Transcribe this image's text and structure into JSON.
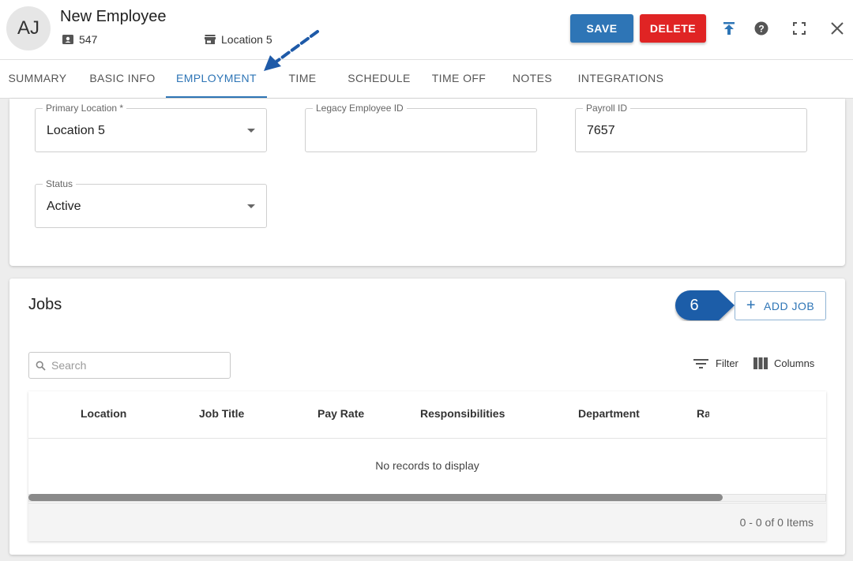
{
  "header": {
    "avatar_initials": "AJ",
    "employee_name": "New Employee",
    "employee_id": "547",
    "location": "Location 5",
    "save_label": "SAVE",
    "delete_label": "DELETE",
    "colors": {
      "save": "#2e75b6",
      "delete": "#e02424",
      "accent": "#2e75b6"
    }
  },
  "tabs": [
    {
      "label": "SUMMARY"
    },
    {
      "label": "BASIC INFO"
    },
    {
      "label": "EMPLOYMENT",
      "active": true
    },
    {
      "label": "TIME"
    },
    {
      "label": "SCHEDULE"
    },
    {
      "label": "TIME OFF"
    },
    {
      "label": "NOTES"
    },
    {
      "label": "INTEGRATIONS"
    }
  ],
  "employment": {
    "primary_location": {
      "label": "Primary Location *",
      "value": "Location 5"
    },
    "legacy_employee_id": {
      "label": "Legacy Employee ID",
      "value": ""
    },
    "payroll_id": {
      "label": "Payroll ID",
      "value": "7657"
    },
    "status": {
      "label": "Status",
      "value": "Active"
    }
  },
  "jobs": {
    "title": "Jobs",
    "add_job_label": "ADD JOB",
    "callout_number": "6",
    "search_placeholder": "Search",
    "filter_label": "Filter",
    "columns_label": "Columns",
    "columns": [
      "Location",
      "Job Title",
      "Pay Rate",
      "Responsibilities",
      "Department",
      "Ra"
    ],
    "empty_message": "No records to display",
    "pager_text": "0 - 0 of 0 Items"
  }
}
